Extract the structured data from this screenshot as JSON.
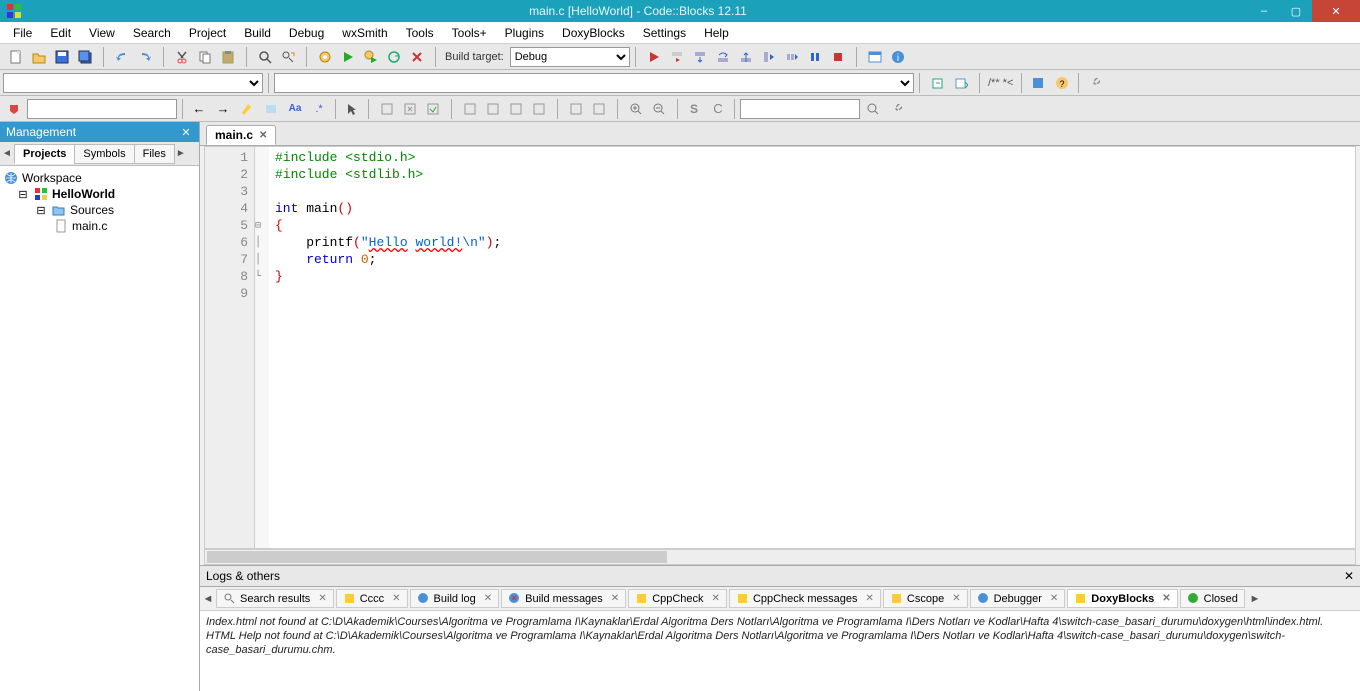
{
  "window": {
    "title": "main.c [HelloWorld] - Code::Blocks 12.11",
    "min": "–",
    "max": "▢",
    "close": "✕"
  },
  "menu": [
    "File",
    "Edit",
    "View",
    "Search",
    "Project",
    "Build",
    "Debug",
    "wxSmith",
    "Tools",
    "Tools+",
    "Plugins",
    "DoxyBlocks",
    "Settings",
    "Help"
  ],
  "build_target_label": "Build target:",
  "build_target_value": "Debug",
  "comment_label": "/** *<",
  "management": {
    "title": "Management",
    "tabs": [
      "Projects",
      "Symbols",
      "Files"
    ],
    "active_tab": 0,
    "tree": {
      "workspace": "Workspace",
      "project": "HelloWorld",
      "sources": "Sources",
      "file": "main.c"
    }
  },
  "editor": {
    "tab": "main.c",
    "lines": [
      "1",
      "2",
      "3",
      "4",
      "5",
      "6",
      "7",
      "8",
      "9"
    ],
    "code": {
      "l1a": "#include ",
      "l1b": "<stdio.h>",
      "l2a": "#include ",
      "l2b": "<stdlib.h>",
      "l4a": "int",
      "l4b": " main",
      "l4c": "()",
      "l5": "{",
      "l6a": "    printf",
      "l6b": "(",
      "l6c": "\"",
      "l6d": "Hello",
      "l6e": " ",
      "l6f": "world!",
      "l6g": "\\n",
      "l6h": "\"",
      "l6i": ")",
      "l6j": ";",
      "l7a": "    ",
      "l7b": "return",
      "l7c": " ",
      "l7d": "0",
      "l7e": ";",
      "l8": "}"
    }
  },
  "logs": {
    "title": "Logs & others",
    "tabs": [
      "Search results",
      "Cccc",
      "Build log",
      "Build messages",
      "CppCheck",
      "CppCheck messages",
      "Cscope",
      "Debugger",
      "DoxyBlocks",
      "Closed"
    ],
    "active_tab": 8,
    "text1": "Index.html not found at C:\\D\\Akademik\\Courses\\Algoritma ve Programlama I\\Kaynaklar\\Erdal Algoritma Ders Notları\\Algoritma ve Programlama I\\Ders Notları ve Kodlar\\Hafta 4\\switch-case_basari_durumu\\doxygen\\html\\index.html.",
    "text2": "HTML Help not found at C:\\D\\Akademik\\Courses\\Algoritma ve Programlama I\\Kaynaklar\\Erdal Algoritma Ders Notları\\Algoritma ve Programlama I\\Ders Notları ve Kodlar\\Hafta 4\\switch-case_basari_durumu\\doxygen\\switch-case_basari_durumu.chm."
  }
}
